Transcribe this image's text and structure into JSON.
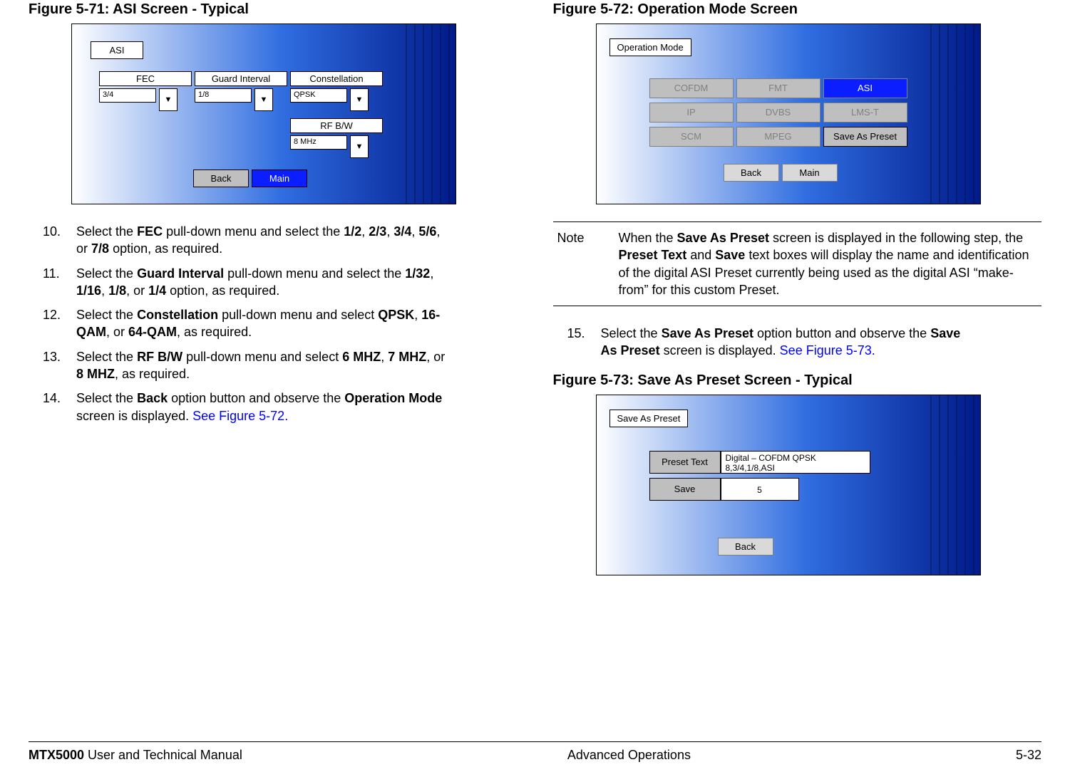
{
  "fig71": {
    "title": "Figure 5-71:   ASI Screen - Typical",
    "tag": "ASI",
    "fec_label": "FEC",
    "guard_label": "Guard Interval",
    "const_label": "Constellation",
    "rf_label": "RF B/W",
    "fec_val": "3/4",
    "guard_val": "1/8",
    "const_val": "QPSK",
    "rf_val": "8 MHz",
    "back": "Back",
    "main": "Main"
  },
  "fig72": {
    "title": "Figure 5-72:   Operation Mode Screen",
    "tag": "Operation Mode",
    "btns": {
      "cofdm": "COFDM",
      "fmt": "FMT",
      "asi": "ASI",
      "ip": "IP",
      "dvbs": "DVBS",
      "lms": "LMS-T",
      "scm": "SCM",
      "mpeg": "MPEG",
      "save": "Save As Preset"
    },
    "back": "Back",
    "main": "Main"
  },
  "fig73": {
    "title": "Figure 5-73:   Save As Preset Screen - Typical",
    "tag": "Save As Preset",
    "preset_lbl": "Preset Text",
    "preset_val": "Digital – COFDM QPSK 8,3/4,1/8,ASI",
    "save_lbl": "Save",
    "save_val": "5",
    "back": "Back"
  },
  "steps_left": {
    "s10": {
      "n": "10.",
      "pre": "Select the ",
      "b1": "FEC",
      "mid1": " pull-down menu and select the ",
      "b2": "1/2",
      "c1": ", ",
      "b3": "2/3",
      "c2": ", ",
      "b4": "3/4",
      "c3": ", ",
      "b5": "5/6",
      "c4": ", or ",
      "b6": "7/8",
      "post": " option, as required."
    },
    "s11": {
      "n": "11.",
      "pre": "Select the ",
      "b1": "Guard Interval",
      "mid1": " pull-down menu and select the ",
      "b2": "1/32",
      "c1": ", ",
      "b3": "1/16",
      "c2": ", ",
      "b4": "1/8",
      "c3": ", or ",
      "b5": "1/4",
      "post": " option, as required."
    },
    "s12": {
      "n": "12.",
      "pre": "Select the ",
      "b1": "Constellation",
      "mid1": " pull-down menu and select ",
      "b2": "QPSK",
      "c1": ", ",
      "b3": "16-QAM",
      "c2": ", or ",
      "b4": "64-QAM",
      "post": ", as required."
    },
    "s13": {
      "n": "13.",
      "pre": "Select the ",
      "b1": "RF B/W",
      "mid1": " pull-down menu and select ",
      "b2": "6 MHZ",
      "c1": ", ",
      "b3": "7 MHZ",
      "c2": ", or ",
      "b4": "8 MHZ",
      "post": ", as required."
    },
    "s14": {
      "n": "14.",
      "pre": "Select the ",
      "b1": "Back",
      "mid1": " option button and observe the ",
      "b2": "Operation Mode",
      "post": " screen is displayed.  ",
      "link": "See Figure 5-72",
      "dot": "."
    }
  },
  "note": {
    "label": "Note",
    "t1": "When the ",
    "b1": "Save As Preset",
    "t2": " screen is displayed in the following step, the ",
    "b2": "Preset Text",
    "t3": " and ",
    "b3": "Save",
    "t4": " text boxes will display the name and identification of the digital ASI Preset currently being used as the digital ASI “make-from” for this custom Preset."
  },
  "step15": {
    "n": "15.",
    "pre": "Select the ",
    "b1": "Save As Preset",
    "mid1": " option button and observe the ",
    "b2": "Save As Preset",
    "post": " screen is displayed.  ",
    "link": "See Figure 5-73",
    "dot": "."
  },
  "footer": {
    "left_bold": "MTX5000",
    "left_rest": " User and Technical Manual",
    "center": "Advanced Operations",
    "right": "5-32"
  },
  "glyphs": {
    "down": "▼"
  }
}
